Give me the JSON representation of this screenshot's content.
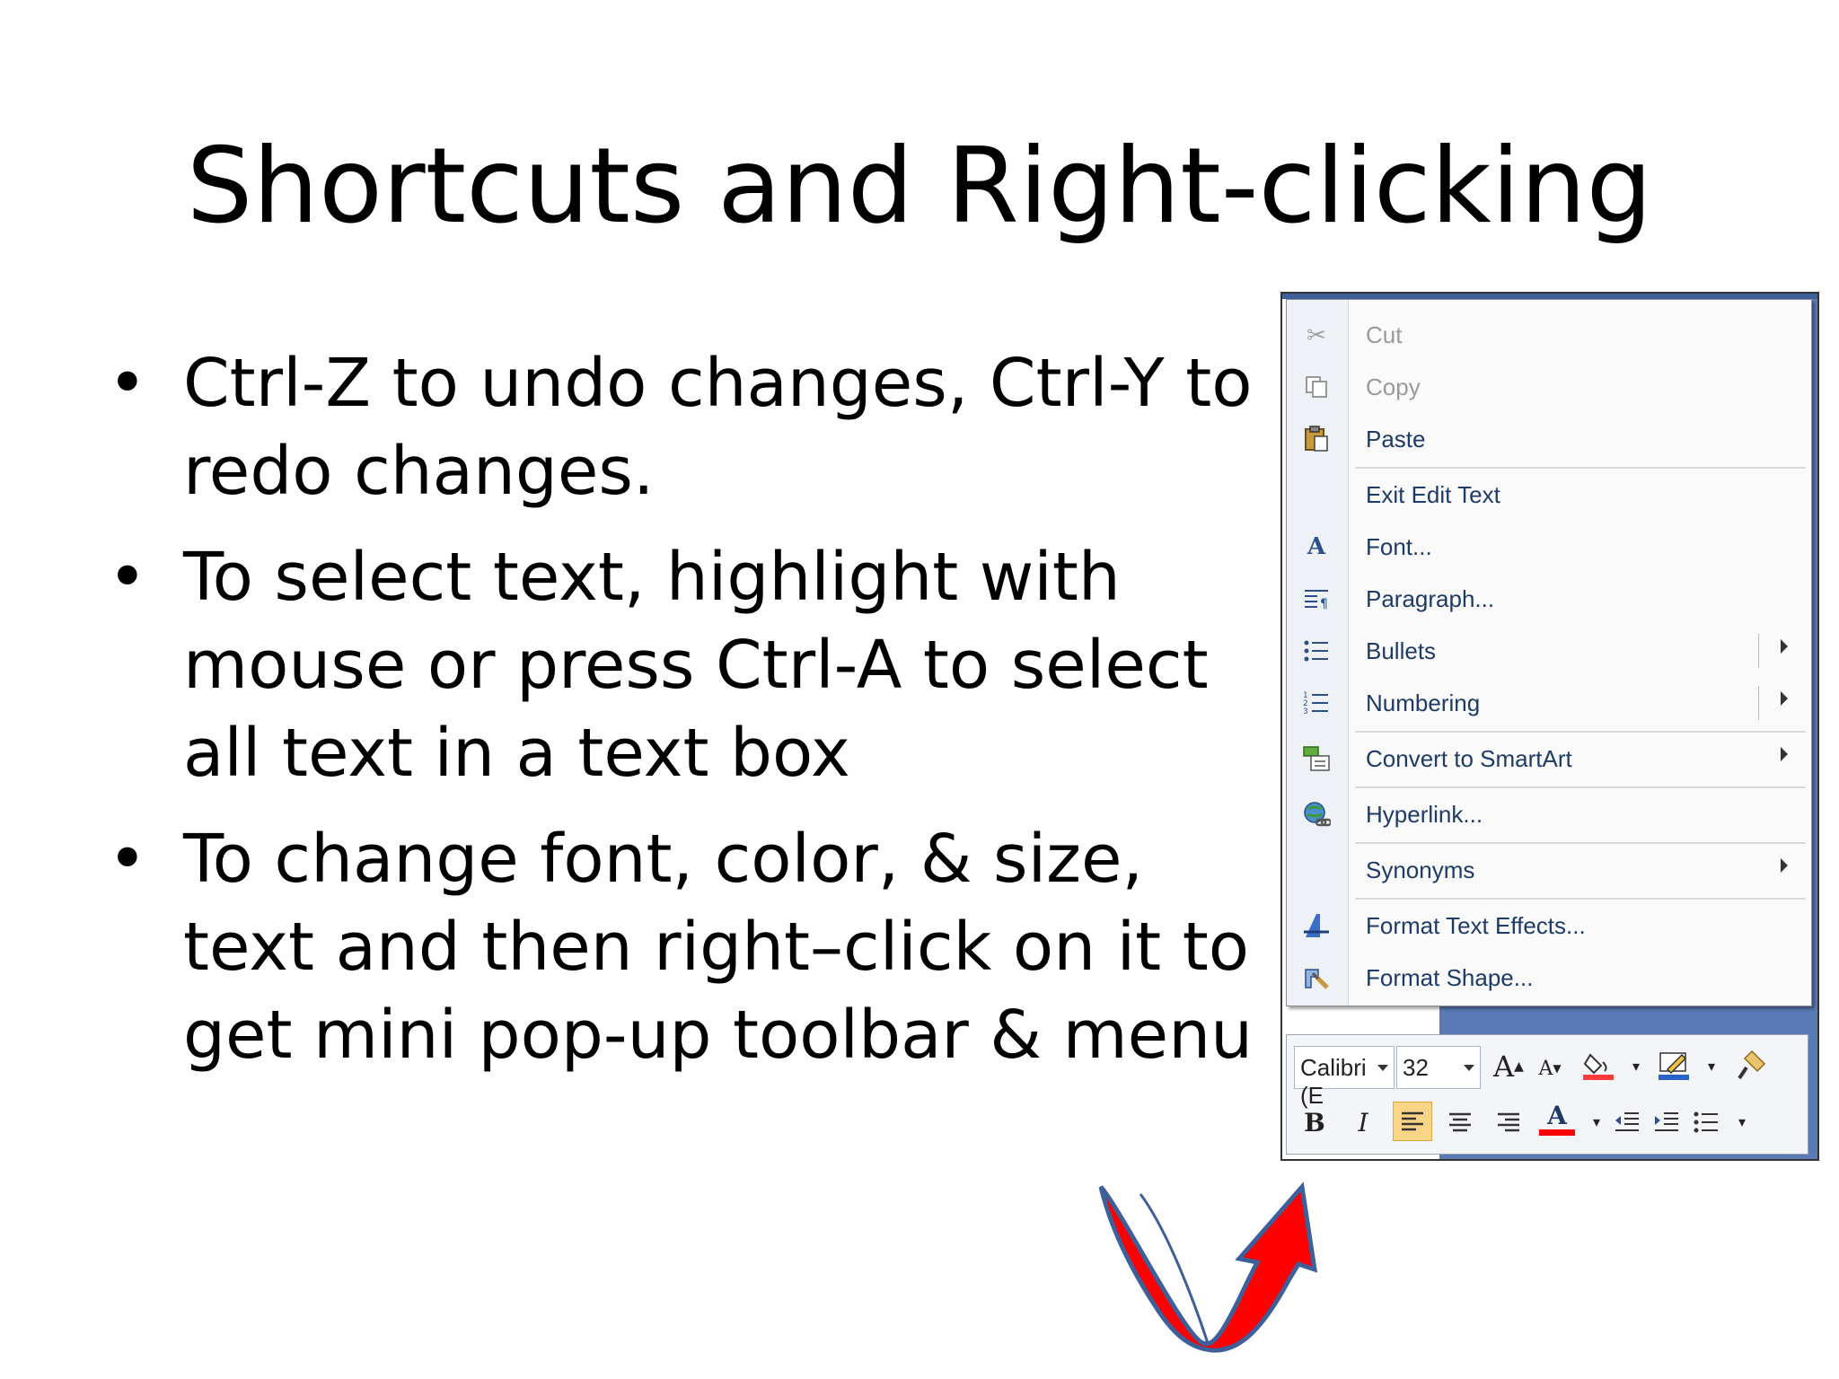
{
  "slide": {
    "title": "Shortcuts and Right-clicking",
    "bullets": [
      "Ctrl-Z to undo changes, Ctrl-Y to redo changes.",
      "To select text, highlight with mouse or press Ctrl-A to select all text in a text box",
      "To change font, color, & size, text and then right–click on it to get mini pop-up toolbar & menu"
    ]
  },
  "context_menu": {
    "items": [
      {
        "label": "Cut",
        "icon": "scissors-icon",
        "disabled": true
      },
      {
        "label": "Copy",
        "icon": "copy-icon",
        "disabled": true
      },
      {
        "label": "Paste",
        "icon": "clipboard-icon",
        "disabled": false
      },
      {
        "label": "Exit Edit Text",
        "icon": "",
        "disabled": false
      },
      {
        "label": "Font...",
        "icon": "font-icon",
        "disabled": false
      },
      {
        "label": "Paragraph...",
        "icon": "paragraph-icon",
        "disabled": false
      },
      {
        "label": "Bullets",
        "icon": "bullets-icon",
        "disabled": false
      },
      {
        "label": "Numbering",
        "icon": "numbering-icon",
        "disabled": false
      },
      {
        "label": "Convert to SmartArt",
        "icon": "smartart-icon",
        "disabled": false
      },
      {
        "label": "Hyperlink...",
        "icon": "hyperlink-icon",
        "disabled": false
      },
      {
        "label": "Synonyms",
        "icon": "",
        "disabled": false
      },
      {
        "label": "Format Text Effects...",
        "icon": "text-effects-icon",
        "disabled": false
      },
      {
        "label": "Format Shape...",
        "icon": "format-shape-icon",
        "disabled": false
      }
    ]
  },
  "mini_toolbar": {
    "font_name": "Calibri (E",
    "font_size": "32",
    "grow_font": "A",
    "shrink_font": "A",
    "bold": "B",
    "italic": "I",
    "font_color": "A"
  },
  "colors": {
    "accent_blue": "#5a7bb5",
    "arrow_red": "#ff0000",
    "arrow_outline": "#3d5f9a"
  }
}
